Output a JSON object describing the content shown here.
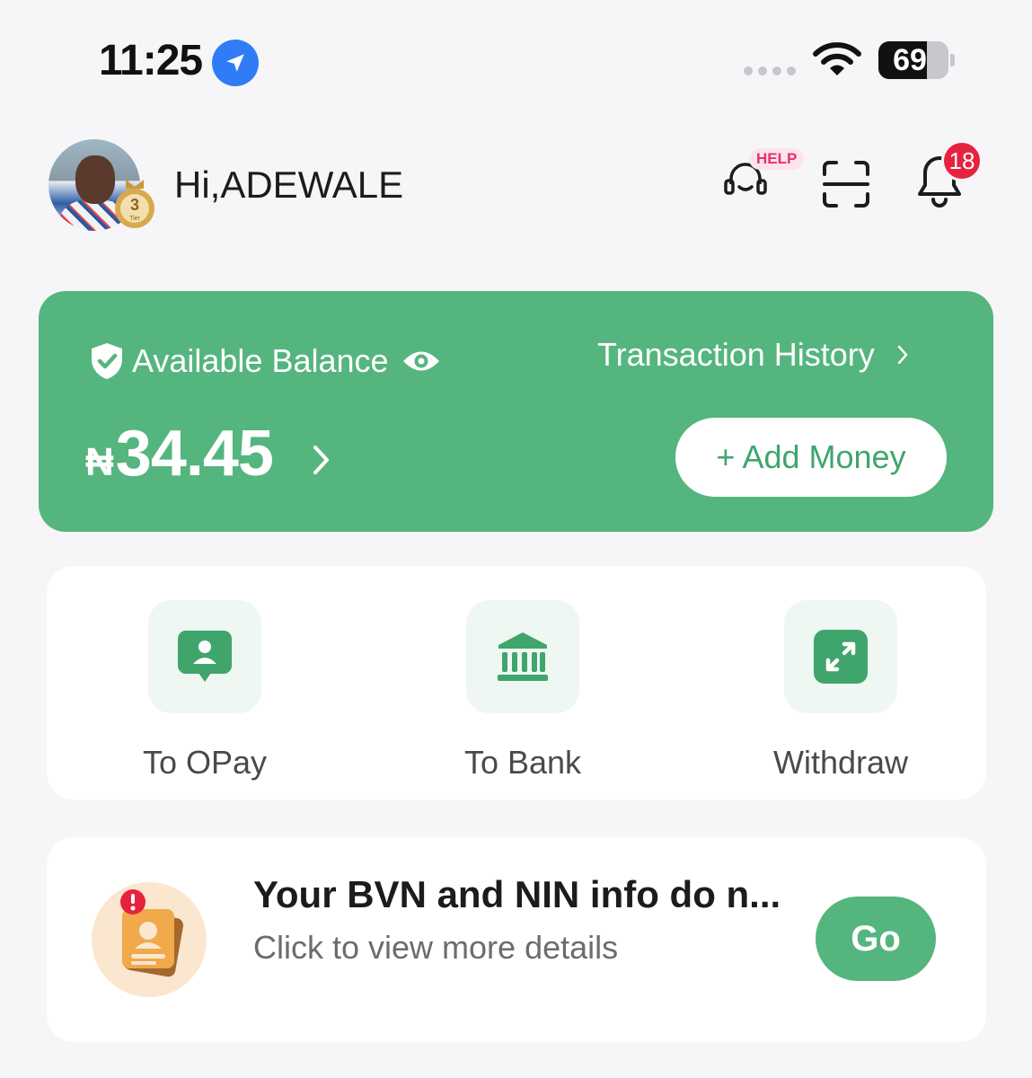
{
  "status_bar": {
    "time": "11:25",
    "battery_percent": "69",
    "battery_level": 0.69,
    "icons": [
      "location-arrow-icon",
      "signal-dots-icon",
      "wifi-icon",
      "battery-icon"
    ]
  },
  "header": {
    "greeting": "Hi,ADEWALE",
    "tier_number": "3",
    "tier_word": "Tier",
    "help_label": "HELP",
    "notification_count": "18",
    "icons": [
      "headset-icon",
      "scan-icon",
      "bell-icon"
    ]
  },
  "balance": {
    "label": "Available Balance",
    "currency": "₦",
    "amount": "34.45",
    "history_label": "Transaction History",
    "add_money_label": "+ Add Money",
    "colors": {
      "card": "#55b57e",
      "accent_text": "#3fa56c"
    }
  },
  "actions": [
    {
      "label": "To OPay",
      "icon": "user-chat-icon"
    },
    {
      "label": "To Bank",
      "icon": "bank-icon"
    },
    {
      "label": "Withdraw",
      "icon": "expand-arrows-icon"
    }
  ],
  "notice": {
    "title": "Your BVN and NIN info do n...",
    "subtitle": "Click to view more details",
    "button": "Go",
    "icon": "id-card-alert-icon"
  }
}
